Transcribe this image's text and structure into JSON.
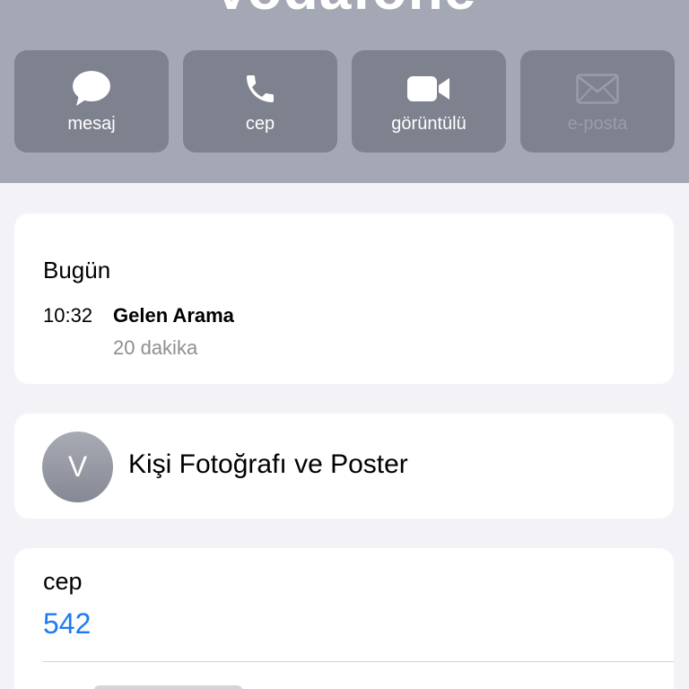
{
  "header": {
    "contact_name": "Vodafone",
    "bg_color": "#a4a7b4",
    "actions": [
      {
        "label": "mesaj",
        "icon": "message-bubble-icon",
        "enabled": true
      },
      {
        "label": "cep",
        "icon": "phone-icon",
        "enabled": true
      },
      {
        "label": "görüntülü",
        "icon": "video-camera-icon",
        "enabled": true
      },
      {
        "label": "e-posta",
        "icon": "mail-icon",
        "enabled": false
      }
    ]
  },
  "recents": {
    "day": "Bugün",
    "calls": [
      {
        "time": "10:32",
        "type": "Gelen Arama",
        "duration": "20 dakika"
      }
    ]
  },
  "poster": {
    "avatar_initial": "V",
    "label": "Kişi Fotoğrafı ve Poster"
  },
  "phone": {
    "label": "cep",
    "number": "542",
    "link_color": "#1e7cf0"
  }
}
